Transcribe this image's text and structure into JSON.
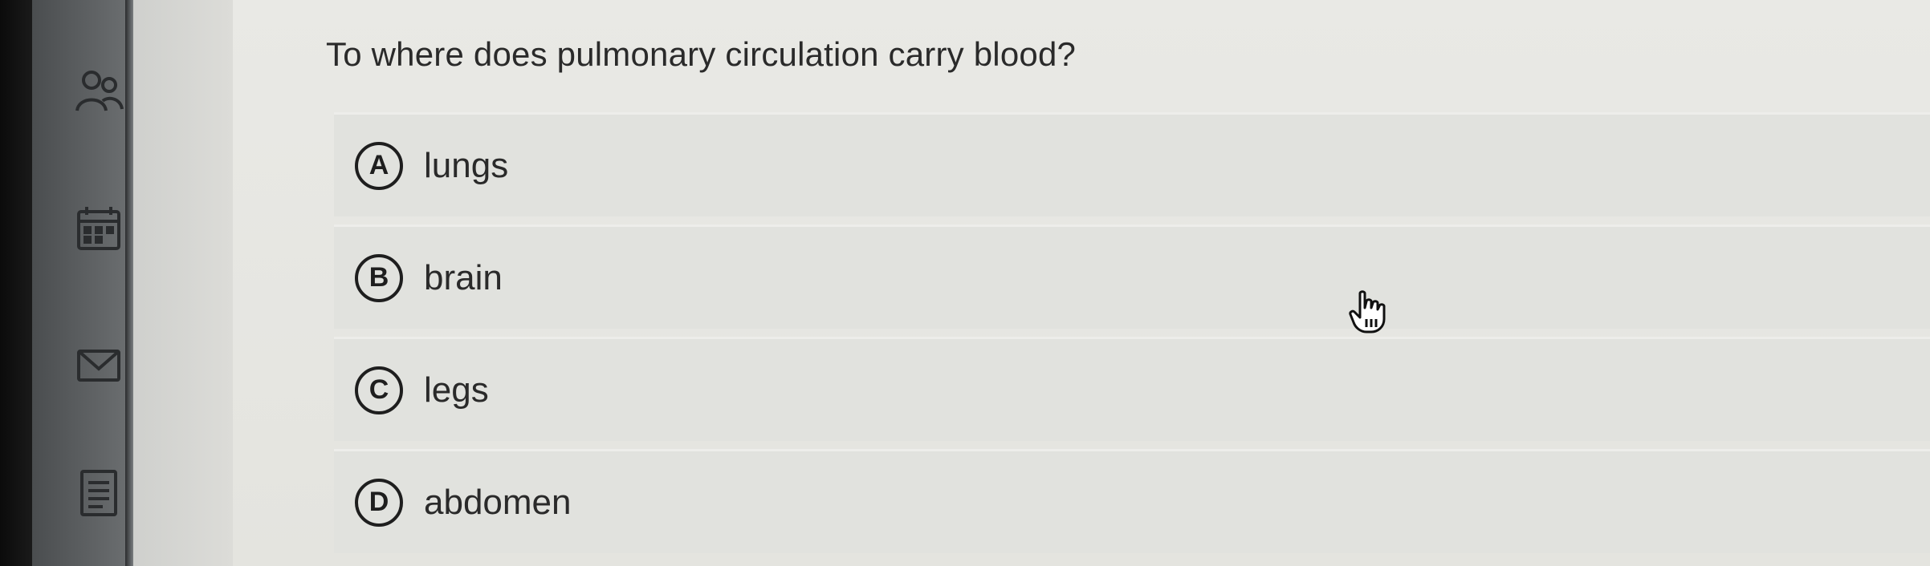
{
  "sidebar": {
    "icons": [
      {
        "name": "people-icon"
      },
      {
        "name": "calendar-icon"
      },
      {
        "name": "mail-icon"
      },
      {
        "name": "document-icon"
      }
    ]
  },
  "question": {
    "text": "To where does pulmonary circulation carry blood?"
  },
  "options": [
    {
      "letter": "A",
      "text": "lungs"
    },
    {
      "letter": "B",
      "text": "brain"
    },
    {
      "letter": "C",
      "text": "legs"
    },
    {
      "letter": "D",
      "text": "abdomen"
    }
  ],
  "cursor": {
    "icon": "hand-pointer-icon"
  },
  "colors": {
    "page_bg": "#e6e6e1",
    "option_bg": "#e1e2de",
    "text": "#2a2a2a",
    "sidebar": "#5d6062"
  }
}
